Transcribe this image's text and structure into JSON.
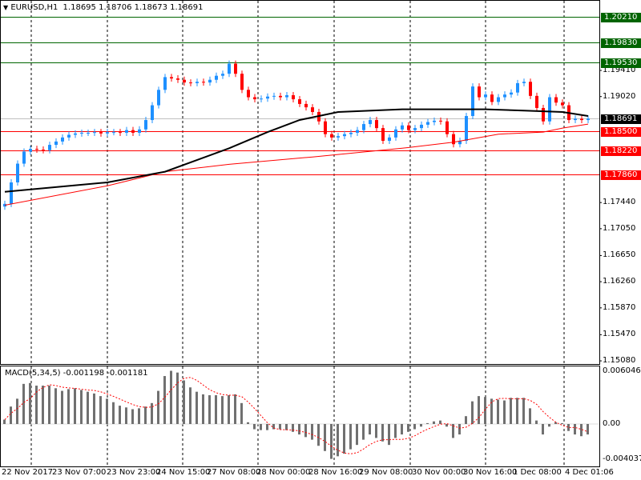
{
  "header": {
    "arrow_icon": "triangle-down-icon",
    "symbol": "EURUSD,H1",
    "ohlc": "1.18695 1.18706 1.18673 1.18691"
  },
  "macd_header": {
    "name": "MACD(5,34,5)",
    "main": "-0.001198",
    "signal": "-0.001181"
  },
  "colors": {
    "bull": "#1e90ff",
    "bear": "#ff0000",
    "ma_slow": "#000000",
    "ma_fast": "#ff0000",
    "level_green": "#006400",
    "level_red": "#ff0000",
    "current": "#000000",
    "histogram": "#707070"
  },
  "levels": [
    {
      "price": 1.2021,
      "label": "1.20210",
      "kind": "green"
    },
    {
      "price": 1.1983,
      "label": "1.19830",
      "kind": "green"
    },
    {
      "price": 1.1953,
      "label": "1.19530",
      "kind": "green"
    },
    {
      "price": 1.185,
      "label": "1.18500",
      "kind": "red"
    },
    {
      "price": 1.1822,
      "label": "1.18220",
      "kind": "red"
    },
    {
      "price": 1.1786,
      "label": "1.17860",
      "kind": "red"
    }
  ],
  "current_price": {
    "price": 1.18691,
    "label": "1.18691"
  },
  "chart_data": {
    "type": "candlestick",
    "symbol": "EURUSD",
    "timeframe": "H1",
    "price_ticks": [
      "1.19410",
      "1.19020",
      "1.17440",
      "1.17050",
      "1.16650",
      "1.16260",
      "1.15870",
      "1.15470",
      "1.15080"
    ],
    "time_ticks": [
      "22 Nov 2017",
      "23 Nov 07:00",
      "23 Nov 23:00",
      "24 Nov 15:00",
      "27 Nov 08:00",
      "28 Nov 00:00",
      "28 Nov 16:00",
      "29 Nov 08:00",
      "30 Nov 00:00",
      "30 Nov 16:00",
      "1 Dec 08:00",
      "4 Dec 01:06"
    ],
    "close": [
      1.1742,
      1.1774,
      1.1802,
      1.182,
      1.1824,
      1.1823,
      1.1822,
      1.183,
      1.1835,
      1.1841,
      1.1845,
      1.1847,
      1.1848,
      1.1848,
      1.1849,
      1.1847,
      1.1849,
      1.1849,
      1.1848,
      1.1852,
      1.1848,
      1.1853,
      1.1867,
      1.1889,
      1.1912,
      1.1931,
      1.1929,
      1.1927,
      1.1923,
      1.1922,
      1.1924,
      1.1923,
      1.1927,
      1.1933,
      1.1936,
      1.1951,
      1.1936,
      1.1912,
      1.1901,
      1.1898,
      1.1899,
      1.1902,
      1.1903,
      1.1901,
      1.1904,
      1.1898,
      1.1891,
      1.1886,
      1.1879,
      1.1865,
      1.1846,
      1.1841,
      1.1843,
      1.1846,
      1.1848,
      1.1852,
      1.1861,
      1.1867,
      1.1855,
      1.1836,
      1.1841,
      1.1853,
      1.1859,
      1.1852,
      1.1855,
      1.186,
      1.1864,
      1.1866,
      1.1865,
      1.1846,
      1.1831,
      1.1836,
      1.1873,
      1.1917,
      1.1901,
      1.1905,
      1.1894,
      1.1901,
      1.1905,
      1.1908,
      1.1922,
      1.1924,
      1.1903,
      1.1885,
      1.1865,
      1.1901,
      1.1893,
      1.1889,
      1.1867,
      1.1869,
      1.1867,
      1.18691
    ],
    "ma_slow": {
      "index": [
        0,
        16,
        25,
        35,
        41,
        46,
        52,
        62,
        75,
        81,
        87,
        91
      ],
      "value": [
        1.176,
        1.1774,
        1.179,
        1.1825,
        1.1849,
        1.1867,
        1.1879,
        1.1883,
        1.1883,
        1.1881,
        1.1879,
        1.1873
      ]
    },
    "ma_fast": {
      "index": [
        0,
        16,
        25,
        35,
        48,
        62,
        70,
        77,
        84,
        87,
        91
      ],
      "value": [
        1.174,
        1.1769,
        1.179,
        1.1801,
        1.1812,
        1.1825,
        1.1834,
        1.1846,
        1.1849,
        1.1855,
        1.1861
      ]
    },
    "macd": {
      "ticks": [
        "0.006046",
        "0.00",
        "-0.004037"
      ],
      "ylim": [
        -0.004037,
        0.006046
      ],
      "histogram": [
        0.0005,
        0.002,
        0.0029,
        0.0046,
        0.0047,
        0.0044,
        0.0044,
        0.0044,
        0.0041,
        0.0038,
        0.004,
        0.0041,
        0.0039,
        0.0037,
        0.0035,
        0.0032,
        0.0029,
        0.0025,
        0.0021,
        0.0019,
        0.0017,
        0.0018,
        0.002,
        0.0024,
        0.0038,
        0.0055,
        0.0061,
        0.0059,
        0.005,
        0.0042,
        0.0037,
        0.0034,
        0.0033,
        0.0033,
        0.0032,
        0.0033,
        0.0034,
        0.0024,
        0.0002,
        -0.0006,
        -0.0007,
        -0.0007,
        -0.0006,
        -0.0006,
        -0.0007,
        -0.0009,
        -0.0012,
        -0.0015,
        -0.0018,
        -0.0025,
        -0.0031,
        -0.004,
        -0.0037,
        -0.0034,
        -0.0029,
        -0.0024,
        -0.0018,
        -0.0012,
        -0.0016,
        -0.002,
        -0.0024,
        -0.0016,
        -0.0012,
        -0.0009,
        -0.0006,
        -0.0003,
        0.0001,
        0.0003,
        0.0004,
        -0.0003,
        -0.0016,
        -0.0012,
        0.0009,
        0.0026,
        0.0032,
        0.0031,
        0.0029,
        0.0028,
        0.0027,
        0.003,
        0.003,
        0.003,
        0.0018,
        0.0004,
        -0.0012,
        -0.0003,
        0.0002,
        0.0001,
        -0.0008,
        -0.0012,
        -0.0014,
        -0.0012
      ]
    }
  }
}
